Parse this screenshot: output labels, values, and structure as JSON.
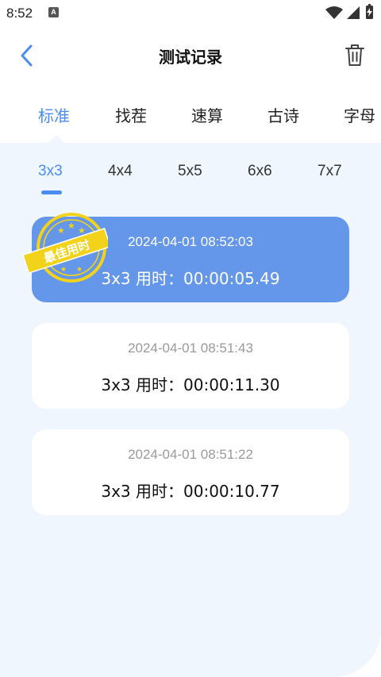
{
  "status_bar": {
    "time": "8:52",
    "notification_icon_letter": "A"
  },
  "header": {
    "title": "测试记录",
    "back_icon": "chevron-left-icon",
    "delete_icon": "trash-icon"
  },
  "category_tabs": [
    {
      "label": "标准",
      "active": true
    },
    {
      "label": "找茬",
      "active": false
    },
    {
      "label": "速算",
      "active": false
    },
    {
      "label": "古诗",
      "active": false
    },
    {
      "label": "字母",
      "active": false
    }
  ],
  "size_tabs": [
    {
      "label": "3x3",
      "active": true
    },
    {
      "label": "4x4",
      "active": false
    },
    {
      "label": "5x5",
      "active": false
    },
    {
      "label": "6x6",
      "active": false
    },
    {
      "label": "7x7",
      "active": false
    }
  ],
  "records": [
    {
      "date": "2024-04-01 08:52:03",
      "time": "3x3 用时：00:00:05.49",
      "best": true
    },
    {
      "date": "2024-04-01 08:51:43",
      "time": "3x3 用时：00:00:11.30",
      "best": false
    },
    {
      "date": "2024-04-01 08:51:22",
      "time": "3x3 用时：00:00:10.77",
      "best": false
    }
  ],
  "best_stamp": {
    "label": "最佳用时"
  },
  "colors": {
    "accent": "#4a8df0",
    "best_card": "#6497e9",
    "panel_background": "#eff6fd",
    "stamp": "#f3d21a"
  }
}
